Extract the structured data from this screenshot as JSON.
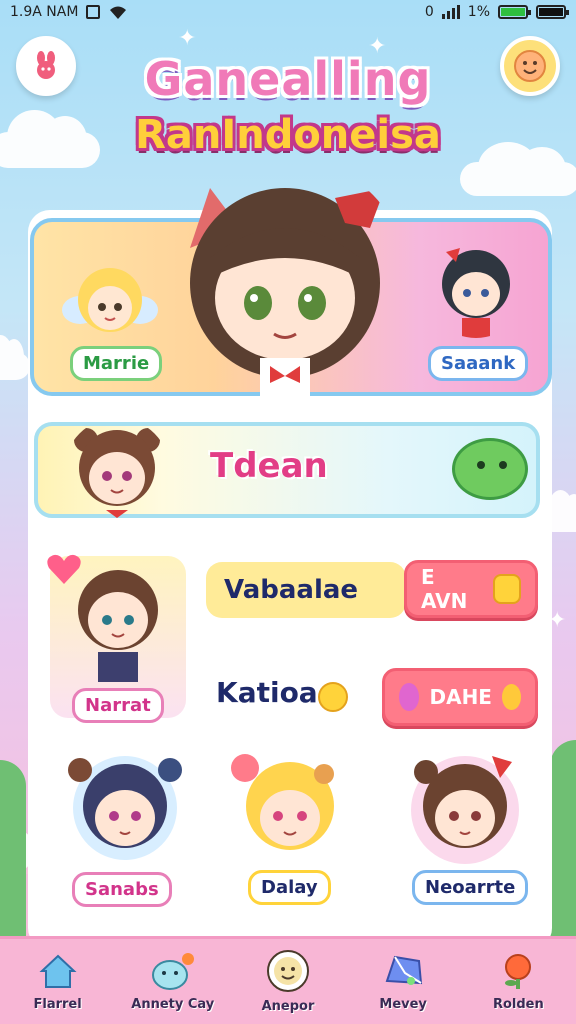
{
  "status_bar": {
    "time": "1.9A NAM",
    "left_icon": "notification-icon",
    "percent": "1%",
    "alarm": "0"
  },
  "header": {
    "title_line1": "Ganealling",
    "title_line2": "RanIndoneisa"
  },
  "featured": {
    "left_chip": "Marrie",
    "right_chip": "Saaank"
  },
  "banner": {
    "title": "Tdean"
  },
  "row1": {
    "card_label": "Narrat",
    "pill_text": "Vabaalae",
    "button_text": "E AVN"
  },
  "row2": {
    "text": "Katioa",
    "button_text": "DAHE"
  },
  "grid": [
    {
      "label": "Sanabs"
    },
    {
      "label": "Dalay"
    },
    {
      "label": "Neoarrte"
    }
  ],
  "nav": [
    {
      "label": "Flarrel",
      "icon": "home-icon"
    },
    {
      "label": "Annety Cay",
      "icon": "pet-icon"
    },
    {
      "label": "Anepor",
      "icon": "face-badge-icon"
    },
    {
      "label": "Mevey",
      "icon": "gem-icon"
    },
    {
      "label": "Rolden",
      "icon": "map-pin-icon"
    }
  ],
  "colors": {
    "accent": "#f07ab8",
    "title_yellow": "#ffcf3a",
    "button": "#ff7b8a",
    "nav_bg": "#f8b6d5"
  }
}
